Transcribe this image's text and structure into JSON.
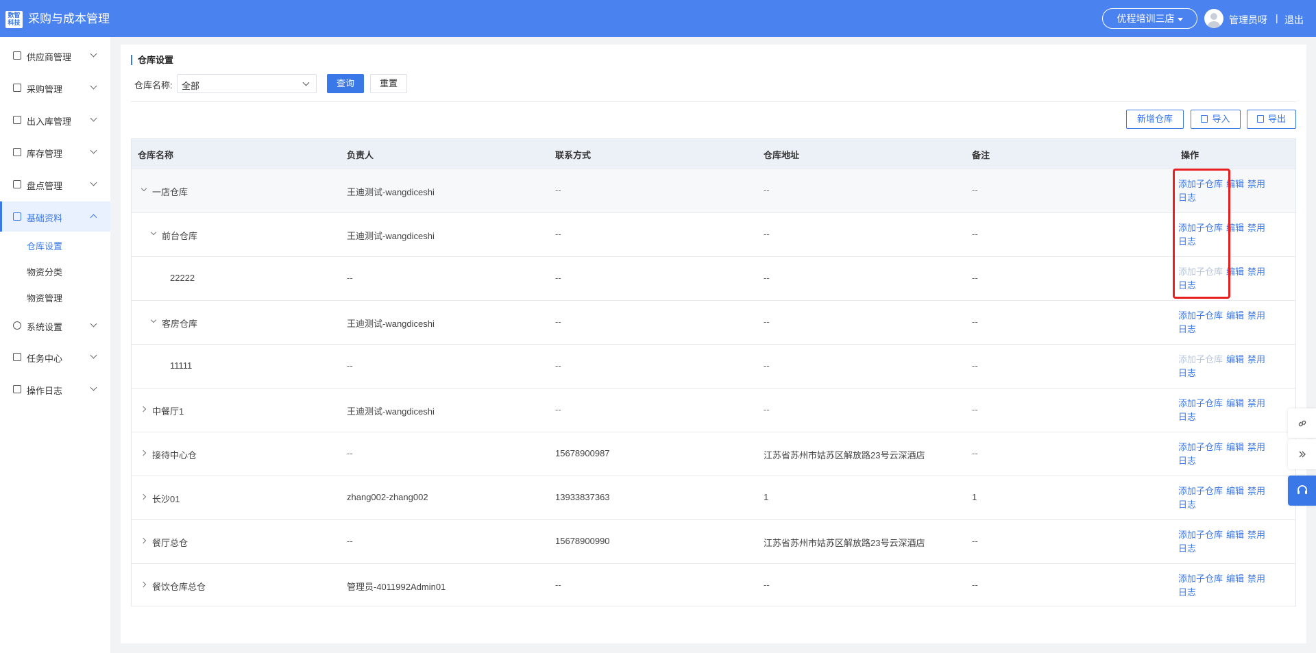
{
  "header": {
    "logo_text": "数智科技",
    "app_title": "采购与成本管理",
    "store_selector": "优程培训三店",
    "user_name": "管理员呀",
    "separator": "|",
    "logout_label": "退出"
  },
  "sidebar": {
    "items": [
      {
        "label": "供应商管理",
        "icon": "supplier-icon"
      },
      {
        "label": "采购管理",
        "icon": "purchase-icon"
      },
      {
        "label": "出入库管理",
        "icon": "inout-icon"
      },
      {
        "label": "库存管理",
        "icon": "stock-icon"
      },
      {
        "label": "盘点管理",
        "icon": "inventory-icon"
      },
      {
        "label": "基础资料",
        "icon": "basic-data-icon",
        "active": true
      },
      {
        "label": "系统设置",
        "icon": "settings-icon"
      },
      {
        "label": "任务中心",
        "icon": "task-icon"
      },
      {
        "label": "操作日志",
        "icon": "log-icon"
      }
    ],
    "sub_items": [
      {
        "label": "仓库设置",
        "active": true
      },
      {
        "label": "物资分类"
      },
      {
        "label": "物资管理"
      }
    ]
  },
  "page": {
    "title": "仓库设置",
    "filter": {
      "label": "仓库名称:",
      "value": "全部"
    },
    "query_label": "查询",
    "reset_label": "重置",
    "add_label": "新增仓库",
    "import_label": "导入",
    "export_label": "导出"
  },
  "table": {
    "columns": [
      "仓库名称",
      "负责人",
      "联系方式",
      "仓库地址",
      "备注",
      "操作"
    ],
    "rows": [
      {
        "name": "一店仓库",
        "manager": "王迪测试-wangdiceshi",
        "contact": "--",
        "address": "--",
        "remark": "--"
      },
      {
        "name": "前台仓库",
        "manager": "王迪测试-wangdiceshi",
        "contact": "--",
        "address": "--",
        "remark": "--"
      },
      {
        "name": "22222",
        "manager": "--",
        "contact": "--",
        "address": "--",
        "remark": "--"
      },
      {
        "name": "客房仓库",
        "manager": "王迪测试-wangdiceshi",
        "contact": "--",
        "address": "--",
        "remark": "--"
      },
      {
        "name": "11111",
        "manager": "--",
        "contact": "--",
        "address": "--",
        "remark": "--"
      },
      {
        "name": "中餐厅1",
        "manager": "王迪测试-wangdiceshi",
        "contact": "--",
        "address": "--",
        "remark": "--"
      },
      {
        "name": "接待中心仓",
        "manager": "--",
        "contact": "15678900987",
        "address": "江苏省苏州市姑苏区解放路23号云深酒店",
        "remark": "--"
      },
      {
        "name": "长沙01",
        "manager": "zhang002-zhang002",
        "contact": "13933837363",
        "address": "1",
        "remark": "1"
      },
      {
        "name": "餐厅总仓",
        "manager": "--",
        "contact": "15678900990",
        "address": "江苏省苏州市姑苏区解放路23号云深酒店",
        "remark": "--"
      },
      {
        "name": "餐饮仓库总仓",
        "manager": "管理员-4011992Admin01",
        "contact": "--",
        "address": "--",
        "remark": "--"
      }
    ],
    "actions": {
      "add_child": "添加子仓库",
      "edit": "编辑",
      "disable": "禁用",
      "log": "日志"
    }
  },
  "float_tools": [
    "link-icon",
    "collapse-icon",
    "headset-icon"
  ],
  "colors": {
    "header": "#4a83f0",
    "accent": "#3a78e8",
    "highlight": "#e81f1f"
  }
}
